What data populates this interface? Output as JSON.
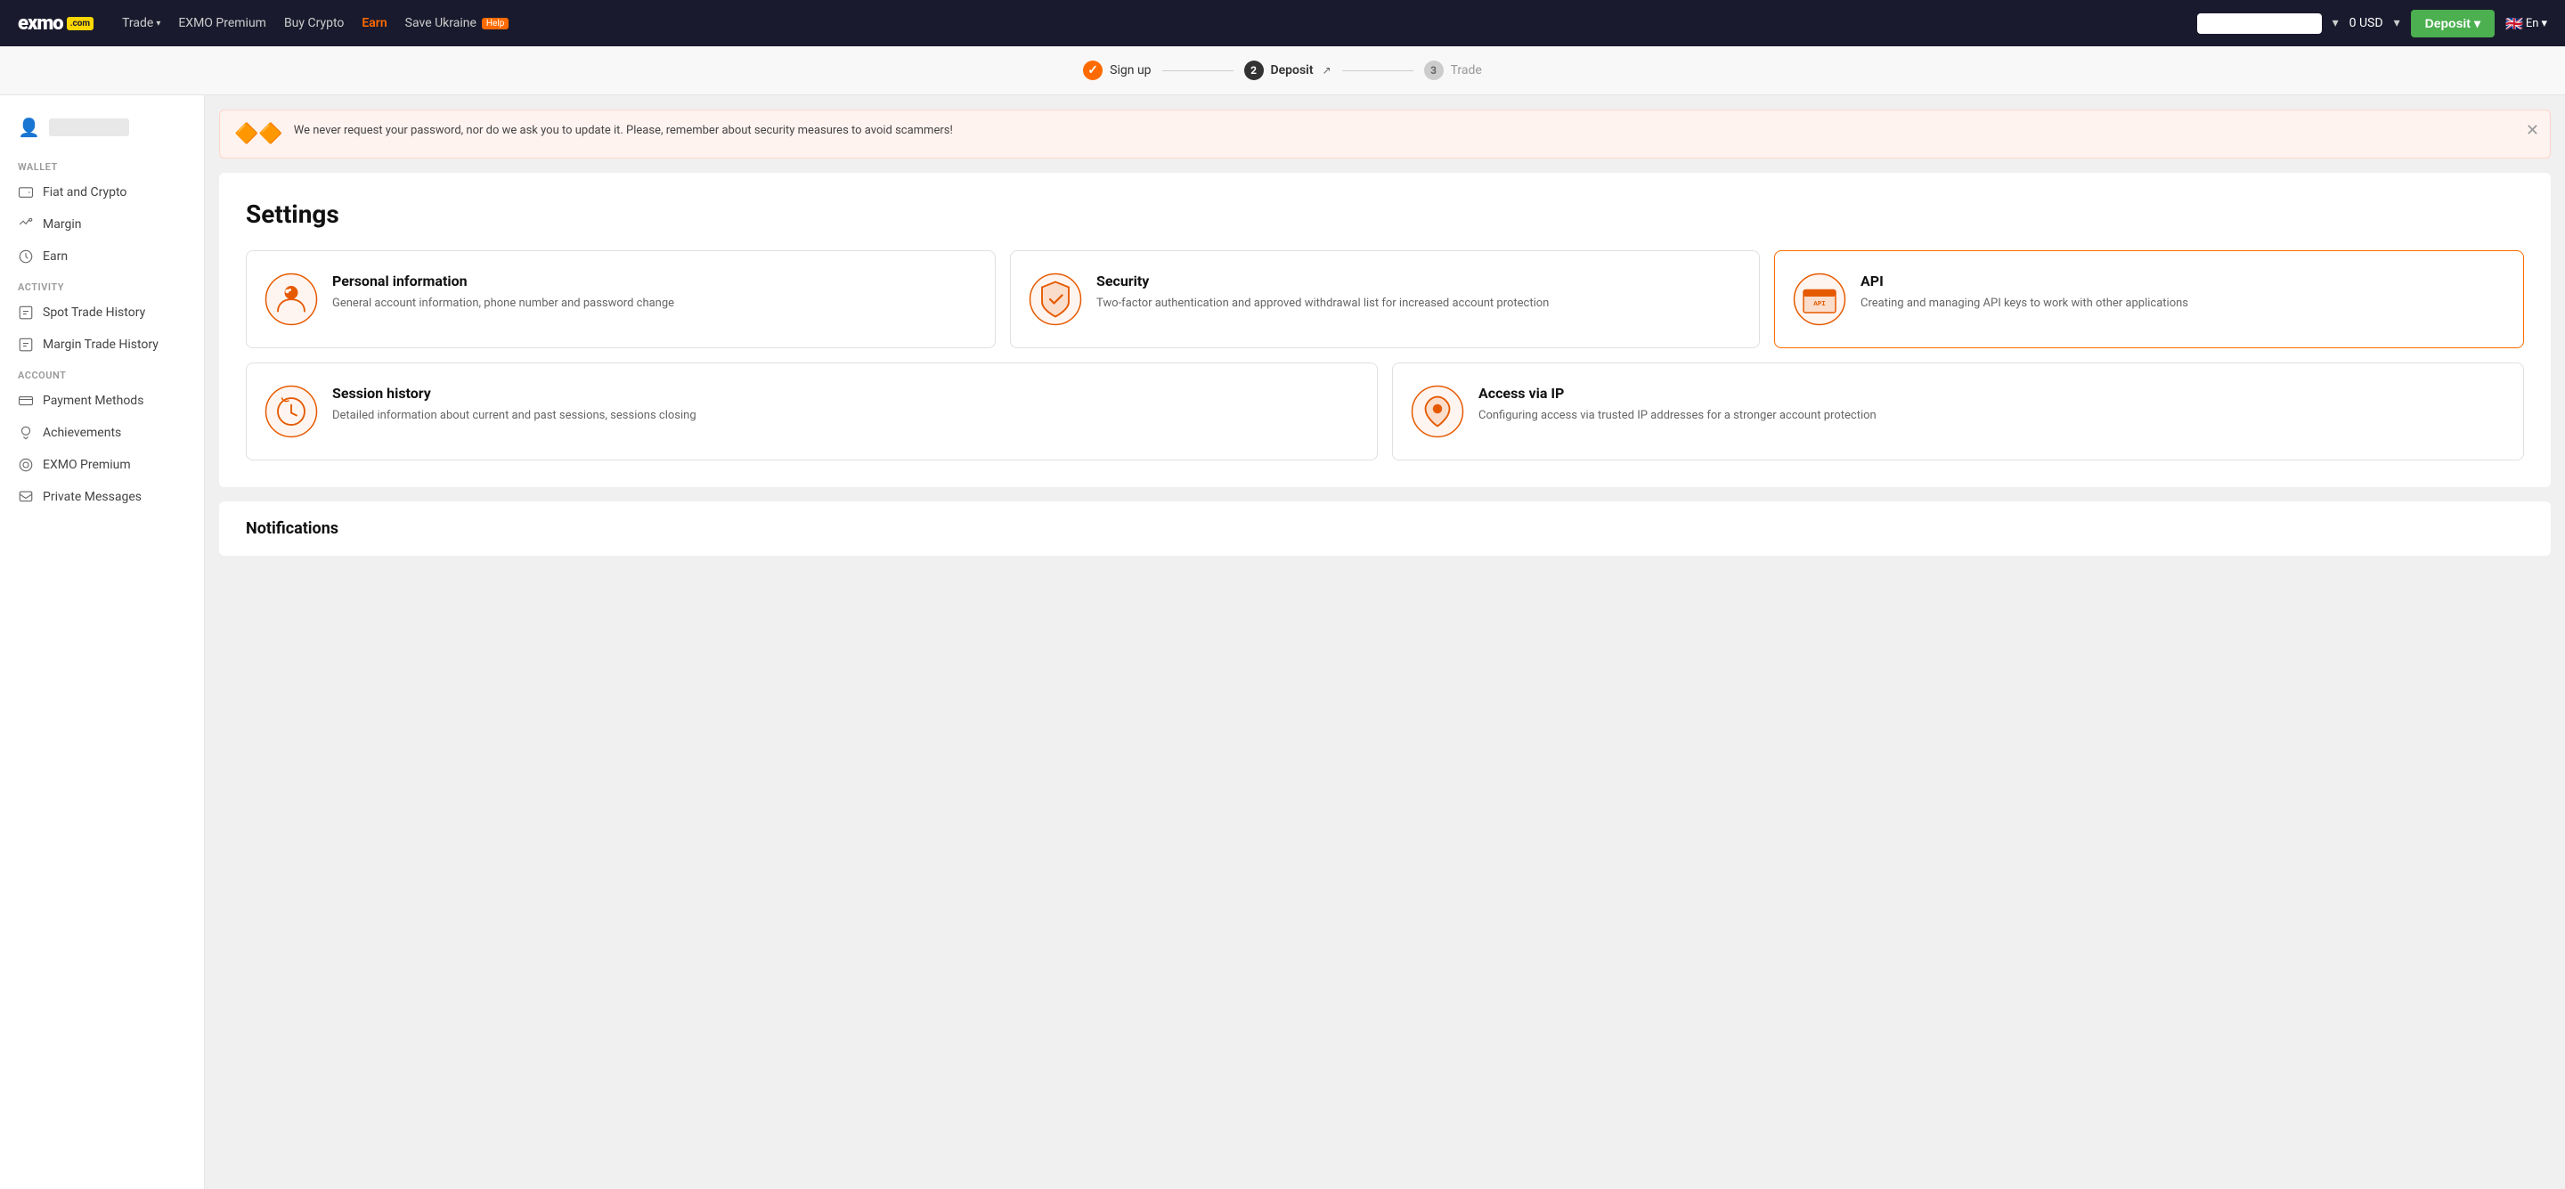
{
  "header": {
    "logo_text": "exmo",
    "logo_com": ".com",
    "nav": [
      {
        "label": "Trade",
        "has_dropdown": true,
        "id": "trade"
      },
      {
        "label": "EXMO Premium",
        "has_dropdown": false,
        "id": "premium"
      },
      {
        "label": "Buy Crypto",
        "has_dropdown": false,
        "id": "buy-crypto"
      },
      {
        "label": "Earn",
        "has_dropdown": false,
        "id": "earn",
        "active": true
      },
      {
        "label": "Save Ukraine",
        "has_dropdown": false,
        "id": "save-ukraine"
      }
    ],
    "help_badge": "Help",
    "search_placeholder": "",
    "balance": "0 USD",
    "deposit_label": "Deposit",
    "lang": "En",
    "flag": "🇬🇧"
  },
  "steps": [
    {
      "num": "✓",
      "label": "Sign up",
      "state": "done"
    },
    {
      "num": "2",
      "label": "Deposit",
      "state": "active",
      "ext": "↗"
    },
    {
      "num": "3",
      "label": "Trade",
      "state": "inactive"
    }
  ],
  "alert": {
    "icon": "🔶🔶",
    "text": "We never request your password, nor do we ask you to update it. Please, remember about security measures to avoid scammers!"
  },
  "sidebar": {
    "username": "",
    "wallet_label": "Wallet",
    "wallet_items": [
      {
        "id": "fiat-crypto",
        "label": "Fiat and Crypto"
      },
      {
        "id": "margin",
        "label": "Margin"
      },
      {
        "id": "earn",
        "label": "Earn"
      }
    ],
    "activity_label": "Activity",
    "activity_items": [
      {
        "id": "spot-trade-history",
        "label": "Spot Trade History"
      },
      {
        "id": "margin-trade-history",
        "label": "Margin Trade History"
      }
    ],
    "account_label": "Account",
    "account_items": [
      {
        "id": "payment-methods",
        "label": "Payment Methods"
      },
      {
        "id": "achievements",
        "label": "Achievements"
      },
      {
        "id": "exmo-premium",
        "label": "EXMO Premium"
      },
      {
        "id": "private-messages",
        "label": "Private Messages"
      }
    ]
  },
  "settings": {
    "title": "Settings",
    "cards": [
      {
        "id": "personal-info",
        "title": "Personal information",
        "desc": "General account information, phone number and password change",
        "highlighted": false
      },
      {
        "id": "security",
        "title": "Security",
        "desc": "Two-factor authentication and approved withdrawal list for increased account protection",
        "highlighted": false
      },
      {
        "id": "api",
        "title": "API",
        "desc": "Creating and managing API keys to work with other applications",
        "highlighted": true
      },
      {
        "id": "session-history",
        "title": "Session history",
        "desc": "Detailed information about current and past sessions, sessions closing",
        "highlighted": false
      },
      {
        "id": "access-via-ip",
        "title": "Access via IP",
        "desc": "Configuring access via trusted IP addresses for a stronger account protection",
        "highlighted": false
      }
    ],
    "notifications_title": "Notifications"
  }
}
